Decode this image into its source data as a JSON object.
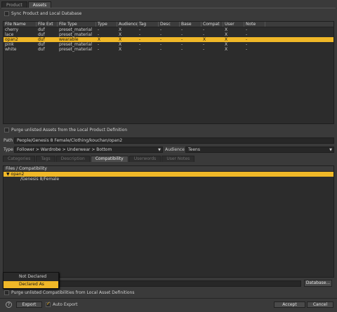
{
  "top_tabs": [
    "Product",
    "Assets"
  ],
  "sync_label": "Sync Product and Local Database",
  "table": {
    "headers": [
      "File Name",
      "File Ext",
      "File Type",
      "Type",
      "Audience",
      "Tag",
      "Desc",
      "Base",
      "Compat",
      "User",
      "Note"
    ],
    "rows": [
      [
        "cherry",
        "duf",
        "preset_material",
        "-",
        "X",
        "-",
        "-",
        "-",
        "-",
        "X",
        "-"
      ],
      [
        "lace",
        "duf",
        "preset_material",
        "-",
        "X",
        "-",
        "-",
        "-",
        "-",
        "X",
        "-"
      ],
      [
        "opan2",
        "duf",
        "wearable",
        "X",
        "X",
        "-",
        "-",
        "-",
        "X",
        "X",
        "-"
      ],
      [
        "pink",
        "duf",
        "preset_material",
        "-",
        "X",
        "-",
        "-",
        "-",
        "-",
        "X",
        "-"
      ],
      [
        "white",
        "duf",
        "preset_material",
        "-",
        "X",
        "-",
        "-",
        "-",
        "-",
        "X",
        "-"
      ]
    ],
    "selected_row": 2
  },
  "purge_assets_label": "Purge unlisted Assets from the Local Product Definition",
  "path": {
    "label": "Path",
    "value": "People/Genesis 8 Female/Clothing/kouchan/opan2"
  },
  "type": {
    "label": "Type",
    "value": "Follower > Wardrobe > Underwear > Bottom"
  },
  "audience": {
    "label": "Audience :",
    "value": "Teens"
  },
  "sub_tabs": [
    "Categories",
    "Tags",
    "Description",
    "Compatibility",
    "Userwords",
    "User Notes"
  ],
  "active_sub_tab": 3,
  "compat": {
    "header": "Files / Compatibility",
    "root": "opan2",
    "child": "/Genesis 8/Female"
  },
  "popup": {
    "items": [
      "Not Declared",
      "Declared As"
    ]
  },
  "database_button": "Database...",
  "purge_compat_label": "Purge unlisted Compatibilities from Local Asset Definitions",
  "bottom": {
    "help": "?",
    "export": "Export",
    "auto_export": "Auto Export",
    "accept": "Accept",
    "cancel": "Cancel"
  },
  "colors": {
    "accent": "#f0b828",
    "background": "#3a3a3a",
    "panel": "#2c2c2c"
  }
}
